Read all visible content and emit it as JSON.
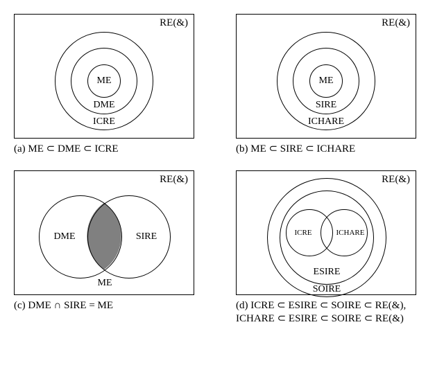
{
  "panels": {
    "a": {
      "corner": "RE(&)",
      "labels": {
        "inner": "ME",
        "mid": "DME",
        "outer": "ICRE"
      },
      "caption": "(a) ME ⊂ DME ⊂ ICRE"
    },
    "b": {
      "corner": "RE(&)",
      "labels": {
        "inner": "ME",
        "mid": "SIRE",
        "outer": "ICHARE"
      },
      "caption": "(b) ME ⊂ SIRE ⊂ ICHARE"
    },
    "c": {
      "corner": "RE(&)",
      "labels": {
        "left": "DME",
        "right": "SIRE",
        "bottom": "ME"
      },
      "caption": "(c) DME ∩ SIRE = ME"
    },
    "d": {
      "corner": "RE(&)",
      "labels": {
        "left": "ICRE",
        "right": "ICHARE",
        "mid": "ESIRE",
        "outer": "SOIRE"
      },
      "caption": "(d) ICRE ⊂ ESIRE ⊂ SOIRE ⊂ RE(&), ICHARE ⊂ ESIRE ⊂ SOIRE ⊂ RE(&)"
    }
  },
  "chart_data": [
    {
      "type": "venn",
      "panel": "a",
      "title": "RE(&)",
      "sets": [
        {
          "name": "ICRE"
        },
        {
          "name": "DME",
          "subset_of": "ICRE"
        },
        {
          "name": "ME",
          "subset_of": "DME"
        }
      ],
      "relation": "ME ⊂ DME ⊂ ICRE"
    },
    {
      "type": "venn",
      "panel": "b",
      "title": "RE(&)",
      "sets": [
        {
          "name": "ICHARE"
        },
        {
          "name": "SIRE",
          "subset_of": "ICHARE"
        },
        {
          "name": "ME",
          "subset_of": "SIRE"
        }
      ],
      "relation": "ME ⊂ SIRE ⊂ ICHARE"
    },
    {
      "type": "venn",
      "panel": "c",
      "title": "RE(&)",
      "sets": [
        {
          "name": "DME"
        },
        {
          "name": "SIRE"
        }
      ],
      "intersection": "ME",
      "relation": "DME ∩ SIRE = ME"
    },
    {
      "type": "venn",
      "panel": "d",
      "title": "RE(&)",
      "sets": [
        {
          "name": "SOIRE"
        },
        {
          "name": "ESIRE",
          "subset_of": "SOIRE"
        },
        {
          "name": "ICRE",
          "subset_of": "ESIRE"
        },
        {
          "name": "ICHARE",
          "subset_of": "ESIRE"
        }
      ],
      "relation": "ICRE ⊂ ESIRE ⊂ SOIRE ⊂ RE(&), ICHARE ⊂ ESIRE ⊂ SOIRE ⊂ RE(&)"
    }
  ]
}
